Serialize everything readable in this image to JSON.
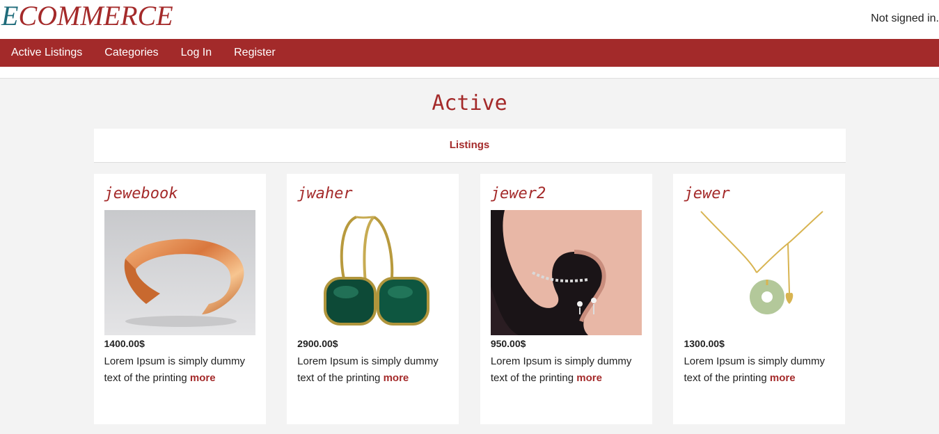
{
  "header": {
    "brand_first": "E",
    "brand_rest": "COMMERCE",
    "signin_status": "Not signed in."
  },
  "nav": {
    "items": [
      {
        "label": "Active Listings"
      },
      {
        "label": "Categories"
      },
      {
        "label": "Log In"
      },
      {
        "label": "Register"
      }
    ]
  },
  "main": {
    "title": "Active",
    "section_label": "Listings",
    "listings": [
      {
        "title": "jewebook",
        "image": "copper-bracelet",
        "price": "1400.00$",
        "description": "Lorem Ipsum is simply dummy text of the printing",
        "more_label": "more"
      },
      {
        "title": "jwaher",
        "image": "green-stone-earrings",
        "price": "2900.00$",
        "description": "Lorem Ipsum is simply dummy text of the printing",
        "more_label": "more"
      },
      {
        "title": "jewer2",
        "image": "ear-climber-earring",
        "price": "950.00$",
        "description": "Lorem Ipsum is simply dummy text of the printing",
        "more_label": "more"
      },
      {
        "title": "jewer",
        "image": "jade-pendant-necklace",
        "price": "1300.00$",
        "description": "Lorem Ipsum is simply dummy text of the printing",
        "more_label": "more"
      }
    ]
  },
  "colors": {
    "accent": "#a32a2a",
    "brand_e": "#1e6b7a",
    "background": "#f3f3f3"
  }
}
